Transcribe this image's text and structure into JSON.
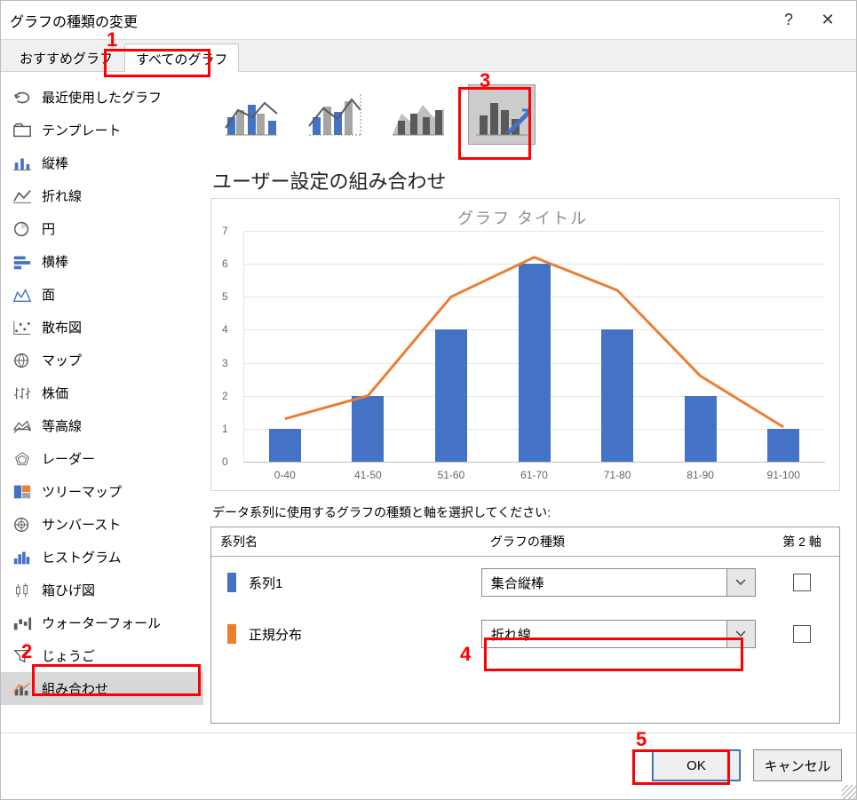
{
  "window": {
    "title": "グラフの種類の変更"
  },
  "tabs": [
    {
      "label": "おすすめグラフ",
      "active": false
    },
    {
      "label": "すべてのグラフ",
      "active": true
    }
  ],
  "categories": [
    {
      "label": "最近使用したグラフ"
    },
    {
      "label": "テンプレート"
    },
    {
      "label": "縦棒"
    },
    {
      "label": "折れ線"
    },
    {
      "label": "円"
    },
    {
      "label": "横棒"
    },
    {
      "label": "面"
    },
    {
      "label": "散布図"
    },
    {
      "label": "マップ"
    },
    {
      "label": "株価"
    },
    {
      "label": "等高線"
    },
    {
      "label": "レーダー"
    },
    {
      "label": "ツリーマップ"
    },
    {
      "label": "サンバースト"
    },
    {
      "label": "ヒストグラム"
    },
    {
      "label": "箱ひげ図"
    },
    {
      "label": "ウォーターフォール"
    },
    {
      "label": "じょうご"
    },
    {
      "label": "組み合わせ"
    }
  ],
  "selected_category_index": 18,
  "section_title": "ユーザー設定の組み合わせ",
  "chart_preview_title": "グラフ タイトル",
  "series_instruction": "データ系列に使用するグラフの種類と軸を選択してください:",
  "series_table": {
    "headers": {
      "name": "系列名",
      "type": "グラフの種類",
      "axis": "第 2 軸"
    },
    "rows": [
      {
        "name": "系列1",
        "color": "#4472c4",
        "type": "集合縦棒",
        "secondary": false
      },
      {
        "name": "正規分布",
        "color": "#ed7d31",
        "type": "折れ線",
        "secondary": false
      }
    ]
  },
  "buttons": {
    "ok": "OK",
    "cancel": "キャンセル"
  },
  "annotations": [
    "1",
    "2",
    "3",
    "4",
    "5"
  ],
  "chart_data": {
    "type": "bar",
    "title": "グラフ タイトル",
    "categories": [
      "0-40",
      "41-50",
      "51-60",
      "61-70",
      "71-80",
      "81-90",
      "91-100"
    ],
    "series": [
      {
        "name": "系列1",
        "type": "bar",
        "color": "#4472c4",
        "values": [
          1,
          2,
          4,
          6,
          4,
          2,
          1
        ]
      },
      {
        "name": "正規分布",
        "type": "line",
        "color": "#ed7d31",
        "values": [
          1.3,
          2.0,
          5.0,
          6.2,
          5.2,
          2.6,
          1.05
        ]
      }
    ],
    "ylabel": "",
    "xlabel": "",
    "ylim": [
      0,
      7
    ],
    "yticks": [
      0,
      1,
      2,
      3,
      4,
      5,
      6,
      7
    ]
  }
}
